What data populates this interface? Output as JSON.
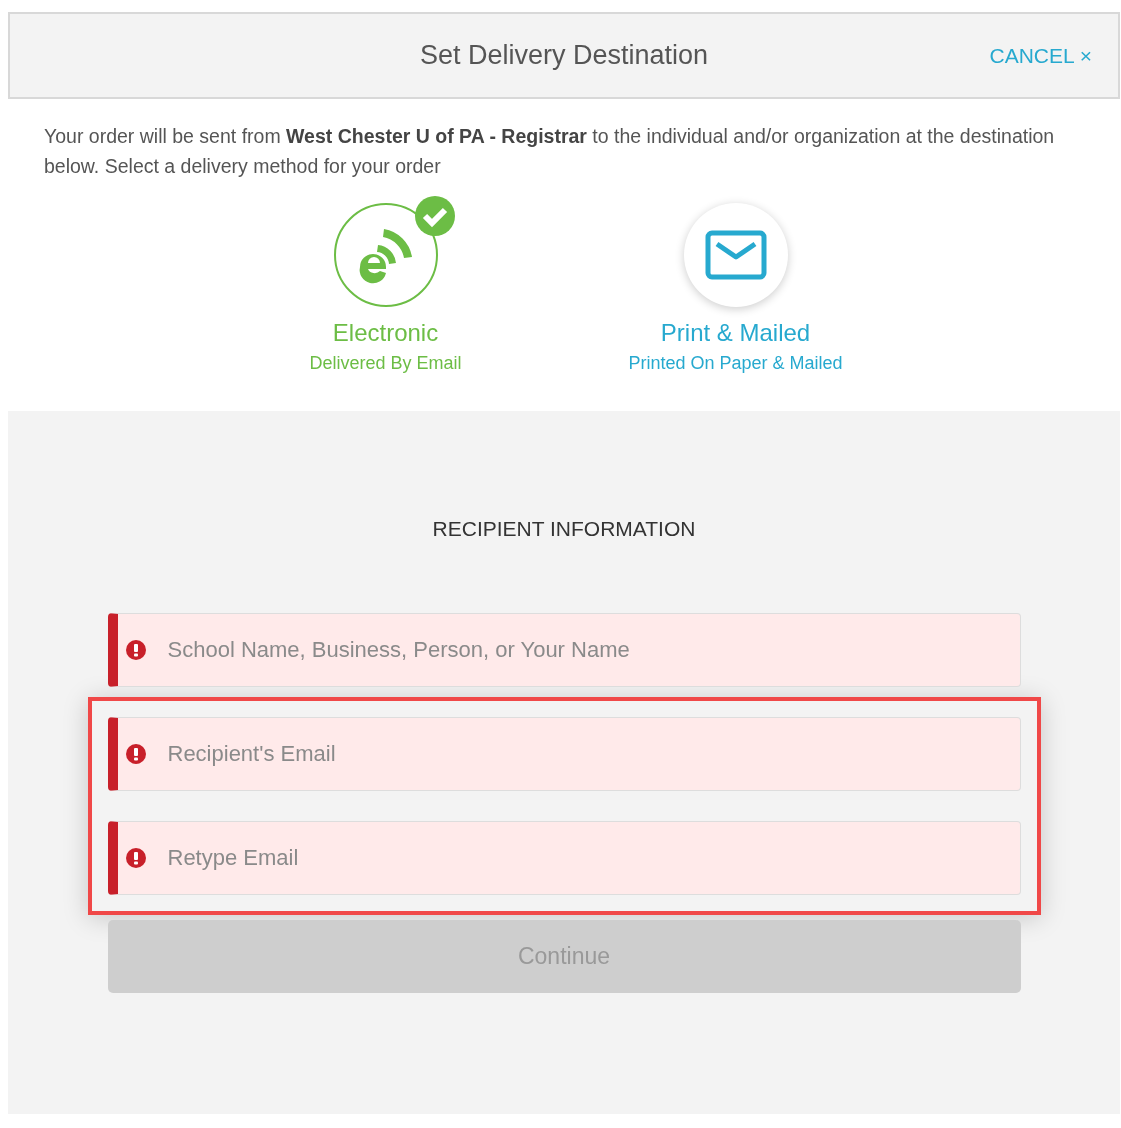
{
  "dialog": {
    "title": "Set Delivery Destination",
    "cancel_label": "CANCEL",
    "close_symbol": "×"
  },
  "intro": "Your order will be sent from **West Chester U of PA - Registrar** to the individual and/or organization at the destination below. Select a delivery method for your order",
  "methods": [
    {
      "kind": "electronic",
      "label": "Electronic",
      "sublabel": "Delivered By Email",
      "selected": true
    },
    {
      "kind": "mail",
      "label": "Print & Mailed",
      "sublabel": "Printed On Paper & Mailed",
      "selected": false
    }
  ],
  "recipient": {
    "heading": "RECIPIENT INFORMATION",
    "field_groups": [
      {
        "highlighted": false,
        "fields": [
          {
            "placeholder": "School Name, Business, Person, or Your Name",
            "invalid": true
          }
        ]
      },
      {
        "highlighted": true,
        "fields": [
          {
            "placeholder": "Recipient's Email",
            "invalid": true
          },
          {
            "placeholder": "Retype Email",
            "invalid": true
          }
        ]
      }
    ],
    "continue_button": {
      "label": "Continue",
      "disabled": true
    }
  }
}
